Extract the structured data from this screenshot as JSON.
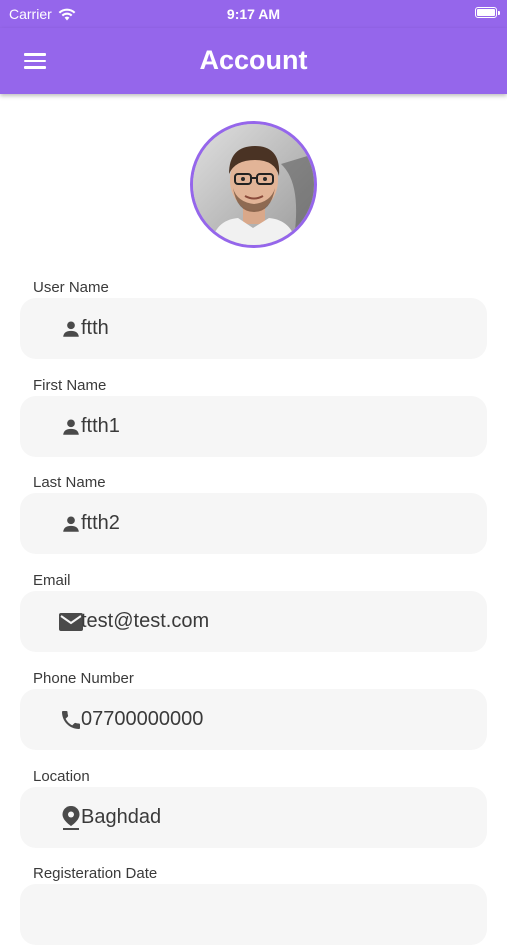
{
  "status_bar": {
    "carrier": "Carrier",
    "time": "9:17 AM"
  },
  "app_bar": {
    "title": "Account",
    "menu_icon": "hamburger-menu-icon"
  },
  "colors": {
    "primary": "#9566eb",
    "field_bg": "#f6f6f6",
    "text": "#3a3a3a",
    "icon": "#4a4a4a"
  },
  "profile": {
    "avatar": "user-avatar-photo"
  },
  "fields": [
    {
      "label": "User Name",
      "value": "ftth",
      "icon": "person-icon"
    },
    {
      "label": "First Name",
      "value": "ftth1",
      "icon": "person-icon"
    },
    {
      "label": "Last Name",
      "value": "ftth2",
      "icon": "person-icon"
    },
    {
      "label": "Email",
      "value": "test@test.com",
      "icon": "email-icon"
    },
    {
      "label": "Phone Number",
      "value": "07700000000",
      "icon": "phone-icon"
    },
    {
      "label": "Location",
      "value": "Baghdad",
      "icon": "location-pin-icon"
    },
    {
      "label": "Registeration Date",
      "value": "",
      "icon": ""
    }
  ]
}
